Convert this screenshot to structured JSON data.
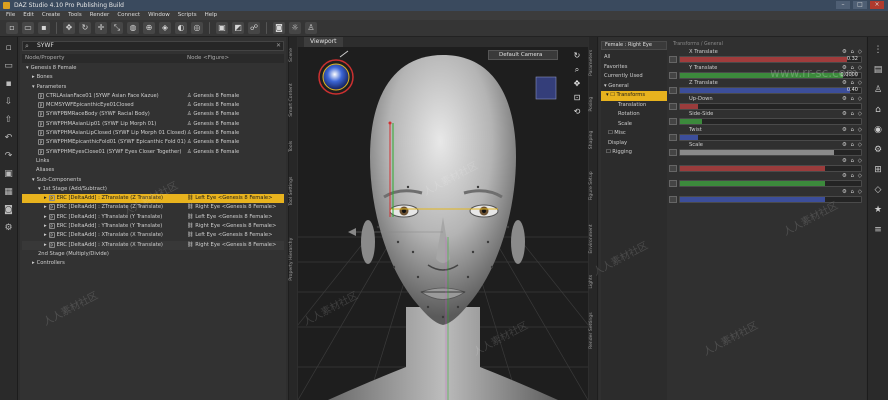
{
  "window": {
    "title": "DAZ Studio 4.10 Pro Publishing Build",
    "controls": [
      "–",
      "□",
      "×"
    ]
  },
  "menu": [
    "File",
    "Edit",
    "Create",
    "Tools",
    "Render",
    "Connect",
    "Window",
    "Scripts",
    "Help"
  ],
  "toolbar_icons": [
    "new-file-icon",
    "open-icon",
    "save-icon",
    "universal-tool-icon",
    "rotate-icon",
    "translate-icon",
    "scale-icon",
    "node-weight-icon",
    "joint-editor-icon",
    "geometry-editor-icon",
    "surface-selection-icon",
    "region-navigator-icon",
    "render-icon",
    "spot-render-icon",
    "active-pose-icon",
    "camera-icon",
    "light-icon",
    "figure-icon"
  ],
  "left_strip_icons": [
    "new-file-icon",
    "open-icon",
    "save-icon",
    "import-icon",
    "export-icon",
    "undo-icon",
    "redo-icon",
    "render-icon",
    "scene-icon",
    "camera-icon",
    "settings-icon"
  ],
  "scene": {
    "search": "SYWF",
    "columns": {
      "node": "Node/Property",
      "node_value": "Node <Figure>"
    },
    "rows": [
      {
        "indent": 4,
        "expand": "▾",
        "label": "Genesis 8 Female",
        "value": "",
        "style": ""
      },
      {
        "indent": 10,
        "expand": "▸",
        "label": "Bones",
        "value": "",
        "style": ""
      },
      {
        "indent": 10,
        "expand": "▾",
        "label": "Parameters",
        "value": "",
        "style": ""
      },
      {
        "indent": 16,
        "expand": "",
        "label": "CTRLAsianFace01 (SYWF Asian Face Kazue)",
        "value": "Genesis 8 Female",
        "style": ""
      },
      {
        "indent": 16,
        "expand": "",
        "label": "MCMSYWFEpicanthicEye01Closed",
        "value": "Genesis 8 Female",
        "style": ""
      },
      {
        "indent": 16,
        "expand": "",
        "label": "SYWFPBMRaceBody (SYWF Racial Body)",
        "value": "Genesis 8 Female",
        "style": ""
      },
      {
        "indent": 16,
        "expand": "",
        "label": "SYWFPHMAsianLip01 (SYWF Lip Morph 01)",
        "value": "Genesis 8 Female",
        "style": ""
      },
      {
        "indent": 16,
        "expand": "",
        "label": "SYWFPHMAsianLipClosed (SYWF Lip Morph 01 Closed)",
        "value": "Genesis 8 Female",
        "style": ""
      },
      {
        "indent": 16,
        "expand": "",
        "label": "SYWFPHMEpicanthicFold01 (SYWF Epicanthic Fold 01)",
        "value": "Genesis 8 Female",
        "style": ""
      },
      {
        "indent": 16,
        "expand": "",
        "label": "SYWFPHMEyesClose01 (SYWF Eyes Closer Together)",
        "value": "Genesis 8 Female",
        "style": ""
      },
      {
        "indent": 14,
        "expand": "",
        "label": "Links",
        "value": "",
        "style": ""
      },
      {
        "indent": 14,
        "expand": "",
        "label": "Aliases",
        "value": "",
        "style": ""
      },
      {
        "indent": 10,
        "expand": "▾",
        "label": "Sub-Components",
        "value": "",
        "style": ""
      },
      {
        "indent": 16,
        "expand": "▾",
        "label": "1st Stage (Add/Subtract)",
        "value": "",
        "style": ""
      },
      {
        "indent": 22,
        "expand": "▸",
        "label": "ERC [DeltaAdd] : ZTranslate (Z Translate)",
        "value": "Left Eye <Genesis 8 Female>",
        "style": "hl"
      },
      {
        "indent": 22,
        "expand": "▸",
        "label": "ERC [DeltaAdd] : ZTranslate (Z Translate)",
        "value": "Right Eye <Genesis 8 Female>",
        "style": ""
      },
      {
        "indent": 22,
        "expand": "▸",
        "label": "ERC [DeltaAdd] : YTranslate (Y Translate)",
        "value": "Left Eye <Genesis 8 Female>",
        "style": ""
      },
      {
        "indent": 22,
        "expand": "▸",
        "label": "ERC [DeltaAdd] : YTranslate (Y Translate)",
        "value": "Right Eye <Genesis 8 Female>",
        "style": ""
      },
      {
        "indent": 22,
        "expand": "▸",
        "label": "ERC [DeltaAdd] : XTranslate (X Translate)",
        "value": "Left Eye <Genesis 8 Female>",
        "style": ""
      },
      {
        "indent": 22,
        "expand": "▸",
        "label": "ERC [DeltaAdd] : XTranslate (X Translate)",
        "value": "Right Eye <Genesis 8 Female>",
        "style": "alt"
      },
      {
        "indent": 16,
        "expand": "",
        "label": "2nd Stage (Multiply/Divide)",
        "value": "",
        "style": ""
      },
      {
        "indent": 10,
        "expand": "▸",
        "label": "Controllers",
        "value": "",
        "style": ""
      }
    ]
  },
  "left_side_tabs": [
    "Scene",
    "Smart Content",
    "Tools",
    "Tool Settings",
    "Property Hierarchy"
  ],
  "viewport": {
    "tab": "Viewport",
    "camera": "Default Camera",
    "controls": [
      "rotate-view-icon",
      "zoom-view-icon",
      "pan-view-icon",
      "frame-icon",
      "reset-view-icon"
    ]
  },
  "right_side_tabs": [
    "Parameters",
    "Posing",
    "Shaping",
    "Figure Setup",
    "Environment",
    "Lights",
    "Render Settings"
  ],
  "parameters": {
    "filter": "Female : Right Eye",
    "tree": [
      {
        "label": "All",
        "indent": 3,
        "style": ""
      },
      {
        "label": "Favorites",
        "indent": 3,
        "style": ""
      },
      {
        "label": "Currently Used",
        "indent": 3,
        "style": ""
      },
      {
        "label": "▾ General",
        "indent": 3,
        "style": ""
      },
      {
        "label": "▾ ☐ Transforms",
        "indent": 5,
        "style": "sel"
      },
      {
        "label": "Translation",
        "indent": 17,
        "style": ""
      },
      {
        "label": "Rotation",
        "indent": 17,
        "style": ""
      },
      {
        "label": "Scale",
        "indent": 17,
        "style": ""
      },
      {
        "label": "☐ Misc",
        "indent": 7,
        "style": ""
      },
      {
        "label": "Display",
        "indent": 7,
        "style": ""
      },
      {
        "label": "☐ Rigging",
        "indent": 5,
        "style": ""
      }
    ],
    "header": "Transforms / General",
    "sliders": [
      {
        "label": "X Translate",
        "value": "0.32",
        "fill": 0.92,
        "color": "#a03c3c"
      },
      {
        "label": "Y Translate",
        "value": "0.0000",
        "fill": 0.9,
        "color": "#3c8a3c"
      },
      {
        "label": "Z Translate",
        "value": "0.40",
        "fill": 0.94,
        "color": "#3c4e9a"
      },
      {
        "label": "Up-Down",
        "value": "",
        "fill": 0.1,
        "color": "#9a3c3c"
      },
      {
        "label": "Side-Side",
        "value": "",
        "fill": 0.12,
        "color": "#3c8a3c"
      },
      {
        "label": "Twist",
        "value": "",
        "fill": 0.1,
        "color": "#3c4e9a"
      },
      {
        "label": "Scale",
        "value": "",
        "fill": 0.85,
        "color": "#8a8a8a"
      },
      {
        "label": "",
        "value": "",
        "fill": 0.8,
        "color": "#9a3c3c"
      },
      {
        "label": "",
        "value": "",
        "fill": 0.8,
        "color": "#3c8a3c"
      },
      {
        "label": "",
        "value": "",
        "fill": 0.8,
        "color": "#3c4e9a"
      }
    ]
  },
  "right_strip_icons": [
    "drag-handle-icon",
    "timeline-icon",
    "pose-icon",
    "lock-icon",
    "eye-icon",
    "settings-icon",
    "ruler-icon",
    "shield-icon",
    "star-icon",
    "menu-icon"
  ],
  "watermark": {
    "text": "人人素材社区",
    "url": "www.rr-sc.com"
  }
}
